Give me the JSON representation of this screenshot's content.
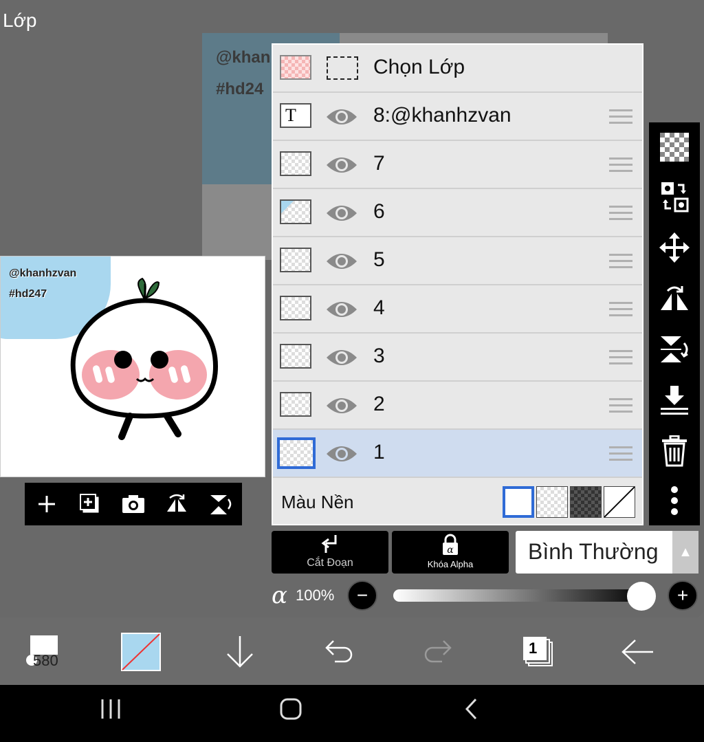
{
  "title": "Lớp",
  "canvas": {
    "text_line1": "@khan",
    "text_line2": "#hd24"
  },
  "preview": {
    "text_line1": "@khanhzvan",
    "text_line2": "#hd247",
    "tools": [
      "add-icon",
      "add-layer-icon",
      "camera-icon",
      "flip-horizontal-icon",
      "flip-vertical-icon"
    ]
  },
  "layers": {
    "select_label": "Chọn Lớp",
    "items": [
      {
        "label": "8:@khanhzvan",
        "type": "text"
      },
      {
        "label": "7",
        "type": "raster"
      },
      {
        "label": "6",
        "type": "raster"
      },
      {
        "label": "5",
        "type": "raster"
      },
      {
        "label": "4",
        "type": "raster"
      },
      {
        "label": "3",
        "type": "raster"
      },
      {
        "label": "2",
        "type": "raster"
      },
      {
        "label": "1",
        "type": "raster",
        "selected": true
      }
    ],
    "background_label": "Màu Nền"
  },
  "right_toolbar": [
    "checker-icon",
    "swap-icon",
    "move-icon",
    "flip-horizontal-icon",
    "flip-vertical-icon",
    "merge-down-icon",
    "trash-icon",
    "more-icon"
  ],
  "controls": {
    "clip_label": "Cắt Đoạn",
    "alpha_lock_label": "Khóa Alpha",
    "blend_mode": "Bình Thường",
    "alpha_symbol": "α",
    "opacity": "100%",
    "opacity_value": 1.0
  },
  "bottom": {
    "brush_size": "580",
    "layers_count": "1"
  },
  "colors": {
    "selected_row": "#cfdcef",
    "accent": "#2f6bd6",
    "primary_color": "#a9d7ef"
  }
}
